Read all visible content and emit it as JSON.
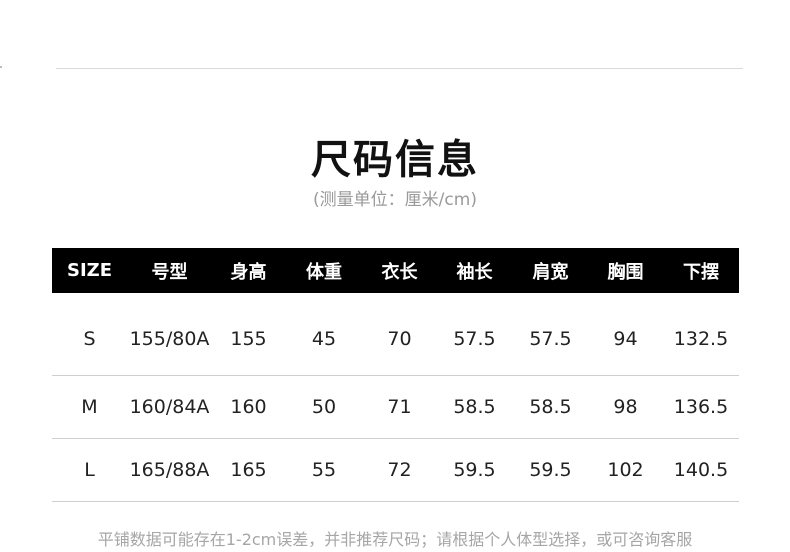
{
  "title": "尺码信息",
  "subtitle": "(测量单位：厘米/cm)",
  "table": {
    "headers": [
      "SIZE",
      "号型",
      "身高",
      "体重",
      "衣长",
      "袖长",
      "肩宽",
      "胸围",
      "下摆"
    ],
    "rows": [
      [
        "S",
        "155/80A",
        "155",
        "45",
        "70",
        "57.5",
        "57.5",
        "94",
        "132.5"
      ],
      [
        "M",
        "160/84A",
        "160",
        "50",
        "71",
        "58.5",
        "58.5",
        "98",
        "136.5"
      ],
      [
        "L",
        "165/88A",
        "165",
        "55",
        "72",
        "59.5",
        "59.5",
        "102",
        "140.5"
      ]
    ]
  },
  "note": "平铺数据可能存在1-2cm误差，并非推荐尺码；请根据个人体型选择，或可咨询客服"
}
